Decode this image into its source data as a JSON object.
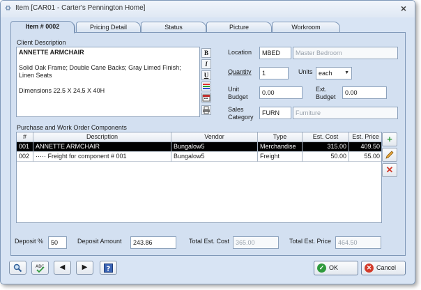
{
  "window": {
    "title": "Item [CAR01 - Carter's Pennington Home]",
    "close": "×"
  },
  "tabs": [
    {
      "label": "Item # 0002",
      "active": true
    },
    {
      "label": "Pricing Detail",
      "active": false
    },
    {
      "label": "Status",
      "active": false
    },
    {
      "label": "Picture",
      "active": false
    },
    {
      "label": "Workroom",
      "active": false
    }
  ],
  "client_description": {
    "label": "Client Description",
    "line1": "ANNETTE ARMCHAIR",
    "line2": "Solid Oak Frame; Double Cane Backs; Gray Limed Finish;",
    "line3": "Linen Seats",
    "line4": "Dimensions 22.5 X 24.5 X 40H"
  },
  "format_buttons": [
    "B",
    "I",
    "U"
  ],
  "location": {
    "label": "Location",
    "code": "MBED",
    "name": "Master Bedroom"
  },
  "quantity": {
    "label": "Quantity",
    "value": "1"
  },
  "units": {
    "label": "Units",
    "value": "each"
  },
  "unit_budget": {
    "label_1": "Unit",
    "label_2": "Budget",
    "value": "0.00"
  },
  "ext_budget": {
    "label_1": "Ext.",
    "label_2": "Budget",
    "value": "0.00"
  },
  "sales_category": {
    "label_1": "Sales",
    "label_2": "Category",
    "code": "FURN",
    "name": "Furniture"
  },
  "components": {
    "label": "Purchase and Work Order Components",
    "columns": [
      "#",
      "Description",
      "Vendor",
      "Type",
      "Est. Cost",
      "Est. Price"
    ],
    "rows": [
      [
        "001",
        "ANNETTE ARMCHAIR",
        "Bungalow5",
        "Merchandise",
        "315.00",
        "409.50"
      ],
      [
        "002",
        "····· Freight for component # 001",
        "Bungalow5",
        "Freight",
        "50.00",
        "55.00"
      ]
    ]
  },
  "deposit_pct": {
    "label": "Deposit %",
    "value": "50"
  },
  "deposit_amount": {
    "label": "Deposit Amount",
    "value": "243.86"
  },
  "total_est_cost": {
    "label": "Total Est. Cost",
    "value": "365.00"
  },
  "total_est_price": {
    "label": "Total Est. Price",
    "value": "464.50"
  },
  "buttons": {
    "ok": "OK",
    "cancel": "Cancel"
  },
  "colors": {
    "accent": "#d3e0f1",
    "selected_row": "#000000",
    "ok_icon": "#2f9a3c",
    "cancel_icon": "#d23a2a"
  }
}
